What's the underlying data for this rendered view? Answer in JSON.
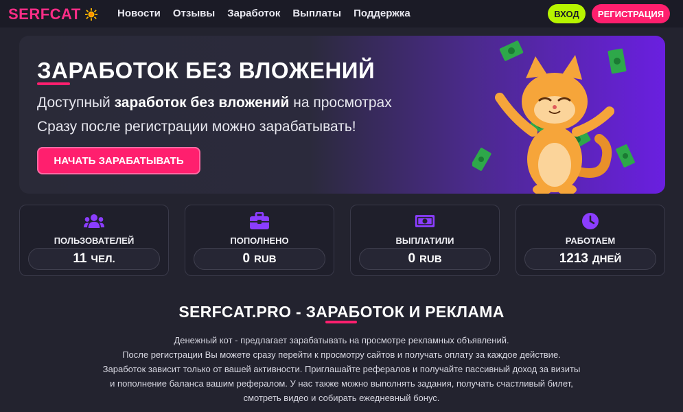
{
  "header": {
    "logo": "SERFCAT",
    "logo_icon": "sun-icon",
    "nav": [
      "Новости",
      "Отзывы",
      "Заработок",
      "Выплаты",
      "Поддержка"
    ],
    "login": "ВХОД",
    "register": "РЕГИСТРАЦИЯ"
  },
  "hero": {
    "title": "ЗАРАБОТОК БЕЗ ВЛОЖЕНИЙ",
    "line1_pre": "Доступный ",
    "line1_bold": "заработок без вложений",
    "line1_post": " на просмотрах",
    "line2": "Сразу после регистрации можно зарабатывать!",
    "cta": "НАЧАТЬ ЗАРАБАТЫВАТЬ",
    "illustration": "cat-with-money-illustration"
  },
  "stats": [
    {
      "icon": "users-icon",
      "label": "ПОЛЬЗОВАТЕЛЕЙ",
      "value": "11",
      "unit": "ЧЕЛ."
    },
    {
      "icon": "briefcase-icon",
      "label": "ПОПОЛНЕНО",
      "value": "0",
      "unit": "RUB"
    },
    {
      "icon": "banknote-icon",
      "label": "ВЫПЛАТИЛИ",
      "value": "0",
      "unit": "RUB"
    },
    {
      "icon": "clock-icon",
      "label": "РАБОТАЕМ",
      "value": "1213",
      "unit": "ДНЕЙ"
    }
  ],
  "about": {
    "title": "SERFCAT.PRO - ЗАРАБОТОК И РЕКЛАМА",
    "lines": [
      "Денежный кот - предлагает зарабатывать на просмотре рекламных объявлений.",
      "После регистрации Вы можете сразу перейти к просмотру сайтов и получать оплату за каждое действие.",
      "Заработок зависит только от вашей активности. Приглашайте рефералов и получайте пассивный доход за визиты",
      "и пополнение баланса вашим рефералом. У нас также можно выполнять задания, получать счастливый билет,",
      "смотреть видео и собирать ежедневный бонус."
    ]
  },
  "colors": {
    "accent_pink": "#ff1f6e",
    "accent_green": "#b7f400",
    "icon_purple": "#8b3dff",
    "background": "#23232f"
  }
}
